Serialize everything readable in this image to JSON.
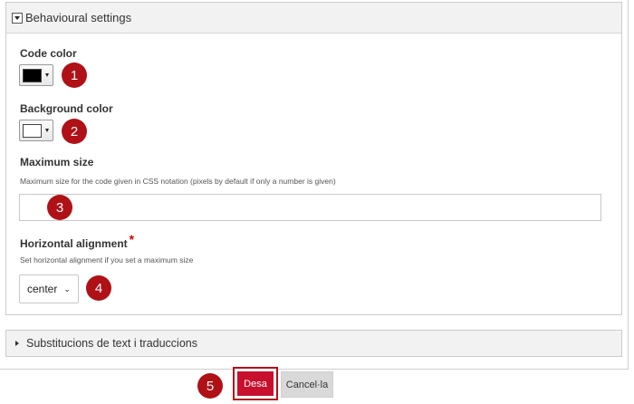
{
  "fieldset": {
    "title": "Behavioural settings"
  },
  "code_color": {
    "label": "Code color",
    "value_color": "#000000"
  },
  "background_color": {
    "label": "Background color",
    "value_color": "#ffffff"
  },
  "maximum_size": {
    "label": "Maximum size",
    "help": "Maximum size for the code given in CSS notation (pixels by default if only a number is given)",
    "value": ""
  },
  "horizontal_alignment": {
    "label": "Horizontal alignment",
    "required_mark": "*",
    "help": "Set horizontal alignment if you set a maximum size",
    "selected": "center"
  },
  "collapsed_section": {
    "title": "Substitucions de text i traduccions"
  },
  "buttons": {
    "save": "Desa",
    "cancel": "Cancel·la"
  },
  "badges": [
    "1",
    "2",
    "3",
    "4",
    "5"
  ],
  "colors": {
    "accent": "#c8102e",
    "badge": "#b01116",
    "required": "#cc0000"
  }
}
